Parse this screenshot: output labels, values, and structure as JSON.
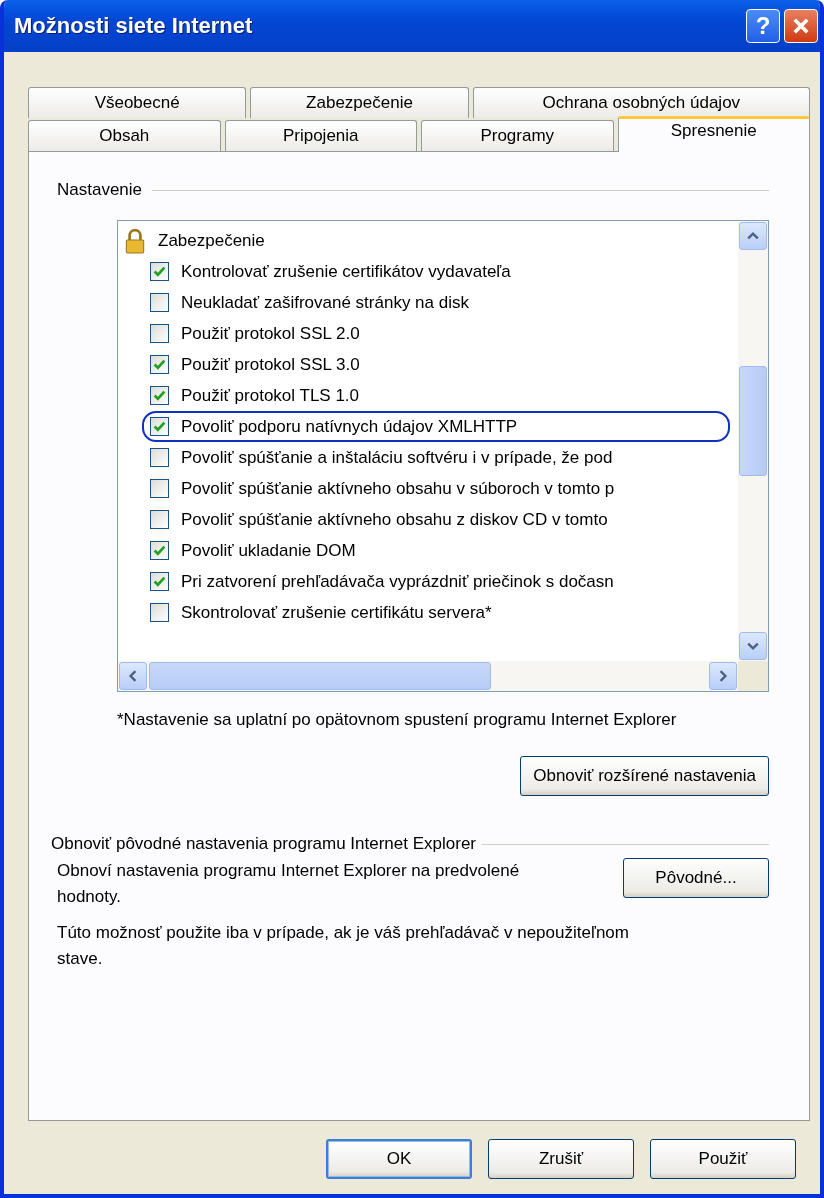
{
  "window": {
    "title": "Možnosti siete Internet",
    "help_button": "?"
  },
  "tab_rows": [
    [
      {
        "label": "Všeobecné",
        "selected": false
      },
      {
        "label": "Zabezpečenie",
        "selected": false
      },
      {
        "label": "Ochrana osobných údajov",
        "selected": false
      }
    ],
    [
      {
        "label": "Obsah",
        "selected": false
      },
      {
        "label": "Pripojenia",
        "selected": false
      },
      {
        "label": "Programy",
        "selected": false
      },
      {
        "label": "Spresnenie",
        "selected": true
      }
    ]
  ],
  "settings": {
    "heading": "Nastavenie",
    "groups": [
      {
        "label": "Zabezpečenie",
        "children": [
          {
            "label": "Kontrolovať zrušenie certifikátov vydavateľa",
            "checked": true,
            "highlighted": false
          },
          {
            "label": "Neukladať zašifrované stránky na disk",
            "checked": false,
            "highlighted": false
          },
          {
            "label": "Použiť protokol SSL 2.0",
            "checked": false,
            "highlighted": false
          },
          {
            "label": "Použiť protokol SSL 3.0",
            "checked": true,
            "highlighted": false
          },
          {
            "label": "Použiť protokol TLS 1.0",
            "checked": true,
            "highlighted": false
          },
          {
            "label": "Povoliť podporu natívnych údajov XMLHTTP",
            "checked": true,
            "highlighted": true
          },
          {
            "label": "Povoliť spúšťanie a inštaláciu softvéru i v prípade, že pod",
            "checked": false,
            "highlighted": false
          },
          {
            "label": "Povoliť spúšťanie aktívneho obsahu v súboroch v tomto p",
            "checked": false,
            "highlighted": false
          },
          {
            "label": "Povoliť spúšťanie aktívneho obsahu z diskov CD v tomto",
            "checked": false,
            "highlighted": false
          },
          {
            "label": "Povoliť ukladanie DOM",
            "checked": true,
            "highlighted": false
          },
          {
            "label": "Pri zatvorení prehľadávača vyprázdniť priečinok s dočasn",
            "checked": true,
            "highlighted": false
          },
          {
            "label": "Skontrolovať zrušenie certifikátu servera*",
            "checked": false,
            "highlighted": false
          }
        ]
      }
    ]
  },
  "note": "*Nastavenie sa uplatní po opätovnom spustení programu Internet Explorer",
  "reset_advanced_button": "Obnoviť rozšírené nastavenia",
  "reset_section": {
    "heading": "Obnoviť pôvodné nastavenia programu Internet Explorer",
    "description": "Obnoví nastavenia programu Internet Explorer na predvolené hodnoty.",
    "button": "Pôvodné...",
    "warning": "Túto možnosť použite iba v prípade, ak je váš prehľadávač v nepoužiteľnom stave."
  },
  "buttons": [
    {
      "label": "OK",
      "default": true
    },
    {
      "label": "Zrušiť",
      "default": false
    },
    {
      "label": "Použiť",
      "default": false
    }
  ]
}
